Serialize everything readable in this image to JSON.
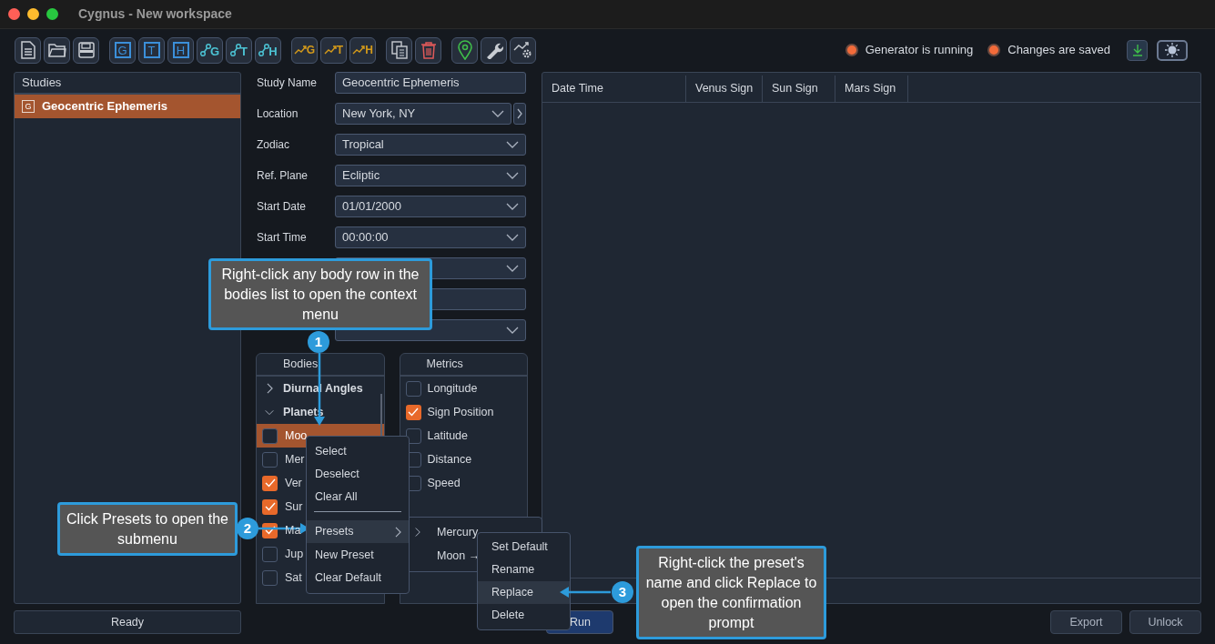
{
  "window": {
    "title": "Cygnus - New workspace"
  },
  "toolbar_groups": [
    [
      {
        "kind": "file"
      },
      {
        "kind": "folder"
      },
      {
        "kind": "save"
      }
    ],
    [
      {
        "kind": "square",
        "letter": "G"
      },
      {
        "kind": "square",
        "letter": "T"
      },
      {
        "kind": "square",
        "letter": "H"
      },
      {
        "kind": "node",
        "letter": "G"
      },
      {
        "kind": "node",
        "letter": "T"
      },
      {
        "kind": "node",
        "letter": "H"
      }
    ],
    [
      {
        "kind": "trend",
        "letter": "G"
      },
      {
        "kind": "trend",
        "letter": "T"
      },
      {
        "kind": "trend",
        "letter": "H"
      }
    ],
    [
      {
        "kind": "copy"
      },
      {
        "kind": "trash"
      }
    ],
    [
      {
        "kind": "pin"
      },
      {
        "kind": "wrench"
      },
      {
        "kind": "trendgear"
      }
    ]
  ],
  "indicators": [
    {
      "label": "Generator is running"
    },
    {
      "label": "Changes are saved"
    }
  ],
  "studies": {
    "title": "Studies",
    "items": [
      {
        "badge": "G",
        "label": "Geocentric Ephemeris",
        "selected": true
      }
    ]
  },
  "form": [
    {
      "kind": "text",
      "label": "Study Name",
      "value": "Geocentric Ephemeris"
    },
    {
      "kind": "dropdown-link",
      "label": "Location",
      "value": "New York, NY"
    },
    {
      "kind": "dropdown",
      "label": "Zodiac",
      "value": "Tropical"
    },
    {
      "kind": "dropdown",
      "label": "Ref. Plane",
      "value": "Ecliptic"
    },
    {
      "kind": "dropdown",
      "label": "Start Date",
      "value": "01/01/2000"
    },
    {
      "kind": "dropdown",
      "label": "Start Time",
      "value": "00:00:00"
    },
    {
      "kind": "dropdown"
    },
    {
      "kind": "text"
    },
    {
      "kind": "dropdown"
    }
  ],
  "bodies": {
    "title": "Bodies",
    "groups": [
      {
        "label": "Diurnal Angles",
        "expanded": false
      },
      {
        "label": "Planets",
        "expanded": true,
        "children": [
          {
            "label": "Moo",
            "checked": false,
            "selected": true
          },
          {
            "label": "Mer",
            "checked": false,
            "selected": false
          },
          {
            "label": "Ver",
            "checked": true,
            "selected": false
          },
          {
            "label": "Sur",
            "checked": true,
            "selected": false
          },
          {
            "label": "Ma",
            "checked": true,
            "selected": false
          },
          {
            "label": "Jup",
            "checked": false,
            "selected": false
          },
          {
            "label": "Sat",
            "checked": false,
            "selected": false
          }
        ]
      }
    ]
  },
  "metrics": {
    "title": "Metrics",
    "items": [
      {
        "label": "Longitude",
        "checked": false
      },
      {
        "label": "Sign Position",
        "checked": true
      },
      {
        "label": "Latitude",
        "checked": false
      },
      {
        "label": "Distance",
        "checked": false
      },
      {
        "label": "Speed",
        "checked": false
      }
    ]
  },
  "table": {
    "columns": [
      "Date Time",
      "Venus Sign",
      "Sun Sign",
      "Mars Sign"
    ]
  },
  "status_bar": "Ready",
  "buttons": {
    "run": "Run",
    "export": "Export",
    "unlock": "Unlock"
  },
  "context_menu": {
    "items": [
      {
        "kind": "item",
        "label": "Select",
        "selected": false
      },
      {
        "kind": "item",
        "label": "Deselect",
        "selected": false
      },
      {
        "kind": "item",
        "label": "Clear All",
        "selected": false
      },
      {
        "kind": "separator"
      },
      {
        "kind": "submenu",
        "label": "Presets",
        "selected": true
      },
      {
        "kind": "item",
        "label": "New Preset",
        "selected": false
      },
      {
        "kind": "item",
        "label": "Clear Default",
        "selected": false
      }
    ]
  },
  "presets_menu": {
    "items": [
      {
        "label": "Mercury",
        "expandable": true
      },
      {
        "label": "Moon →",
        "expandable": false
      }
    ]
  },
  "preset_actions": {
    "items": [
      {
        "label": "Set Default",
        "selected": false
      },
      {
        "label": "Rename",
        "selected": false
      },
      {
        "label": "Replace",
        "selected": true
      },
      {
        "label": "Delete",
        "selected": false
      }
    ]
  },
  "callouts": [
    {
      "number": "1",
      "text": "Right-click any body row in the bodies list to open the context menu"
    },
    {
      "number": "2",
      "text": "Click Presets to open the submenu"
    },
    {
      "number": "3",
      "text": "Right-click the preset's name and click Replace to open the confirmation prompt"
    }
  ]
}
